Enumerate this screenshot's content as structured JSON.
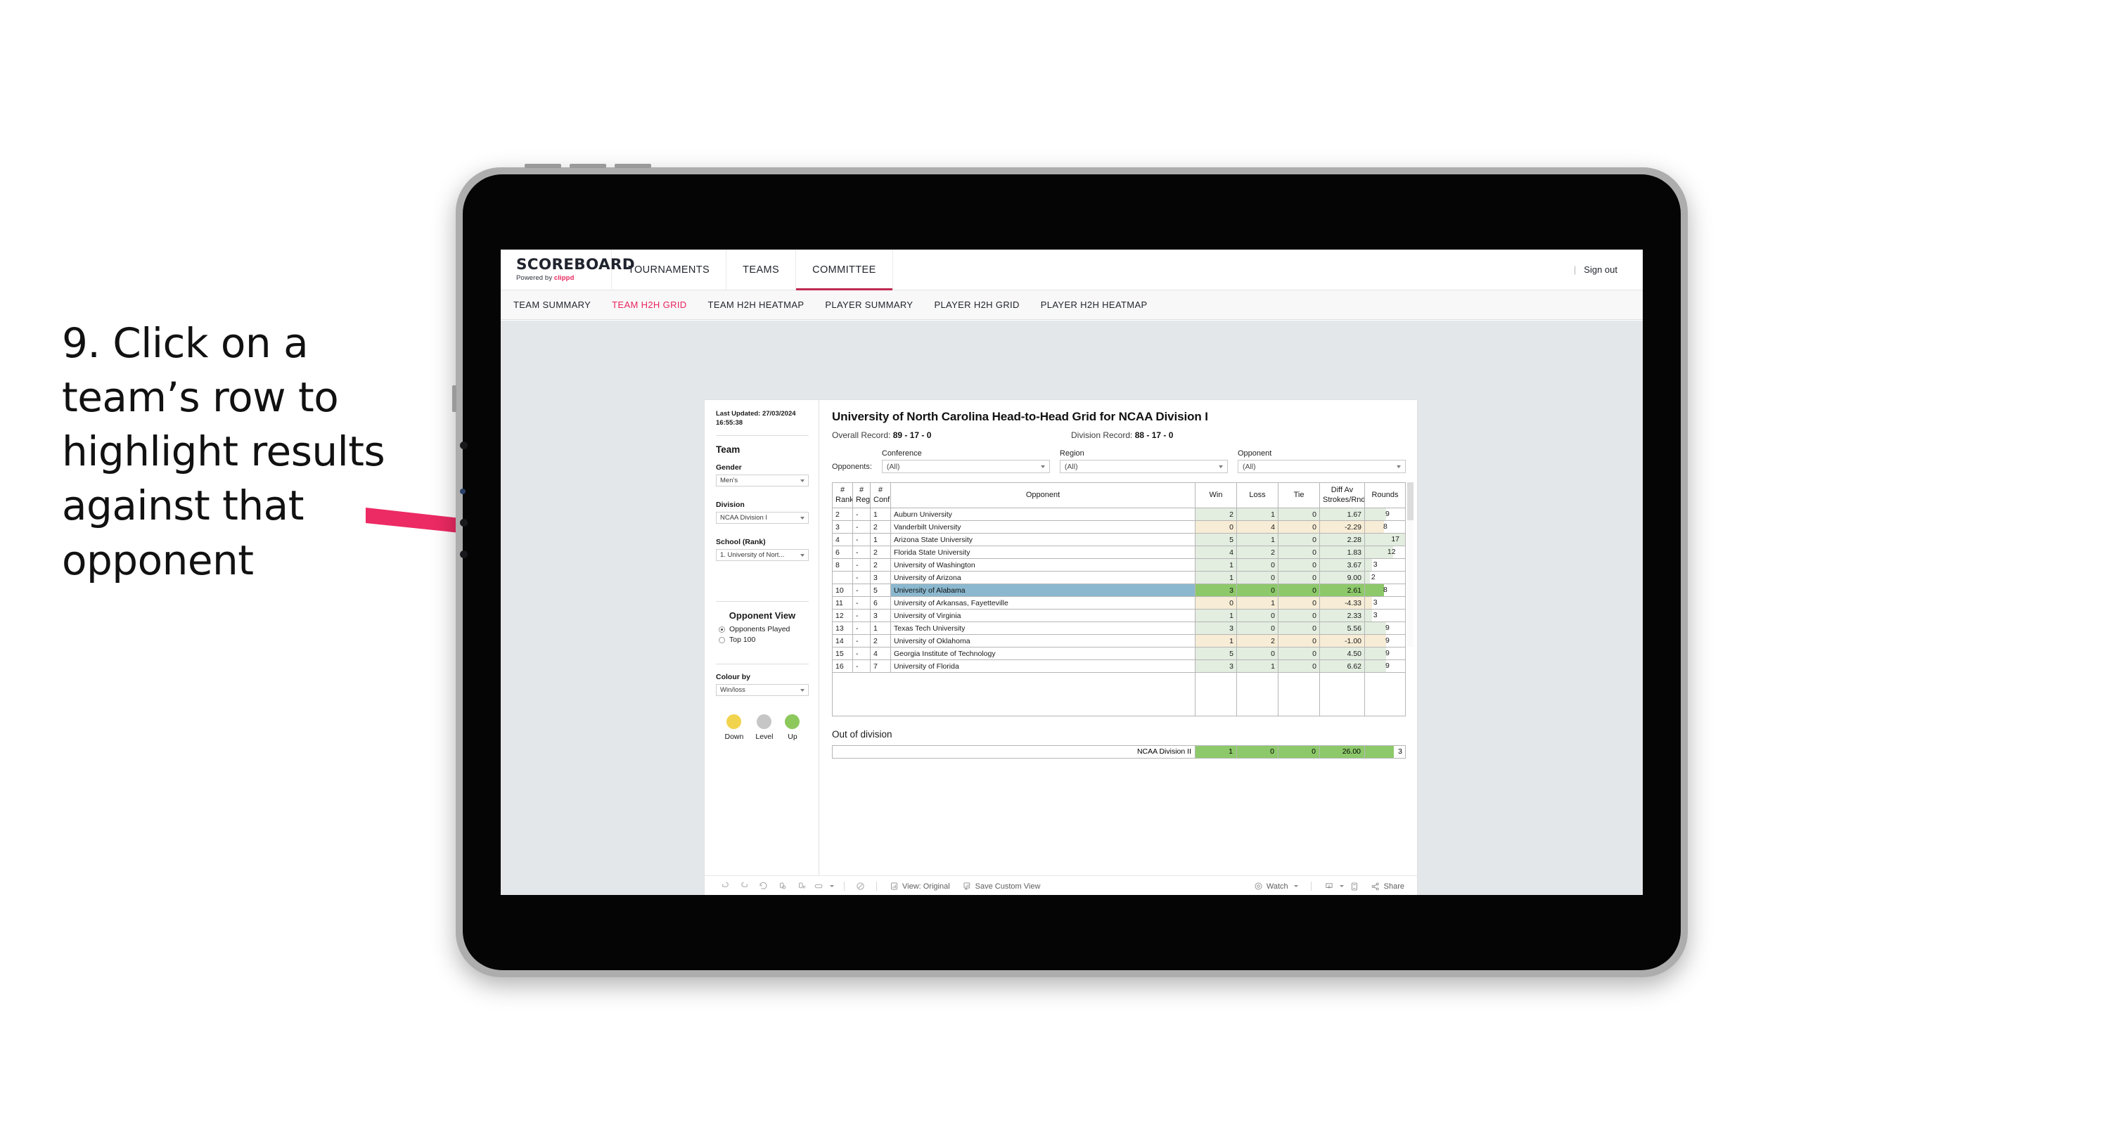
{
  "annotation": {
    "text": "9. Click on a team’s row to highlight results against that opponent"
  },
  "app": {
    "brand_title": "SCOREBOARD",
    "brand_sub_prefix": "Powered by ",
    "brand_sub_name": "clippd",
    "top_nav": [
      {
        "label": "TOURNAMENTS",
        "active": false
      },
      {
        "label": "TEAMS",
        "active": false
      },
      {
        "label": "COMMITTEE",
        "active": true
      }
    ],
    "sign_out": "Sign out",
    "sub_tabs": [
      {
        "label": "TEAM SUMMARY",
        "active": false
      },
      {
        "label": "TEAM H2H GRID",
        "active": true
      },
      {
        "label": "TEAM H2H HEATMAP",
        "active": false
      },
      {
        "label": "PLAYER SUMMARY",
        "active": false
      },
      {
        "label": "PLAYER H2H GRID",
        "active": false
      },
      {
        "label": "PLAYER H2H HEATMAP",
        "active": false
      }
    ]
  },
  "sidebar": {
    "last_updated": "Last Updated: 27/03/2024 16:55:38",
    "team_heading": "Team",
    "gender_label": "Gender",
    "gender_value": "Men’s",
    "division_label": "Division",
    "division_value": "NCAA Division I",
    "school_label": "School (Rank)",
    "school_value": "1. University of Nort...",
    "opponent_view_heading": "Opponent View",
    "opponent_view_options": [
      {
        "label": "Opponents Played",
        "selected": true
      },
      {
        "label": "Top 100",
        "selected": false
      }
    ],
    "colour_by_label": "Colour by",
    "colour_by_value": "Win/loss",
    "legend": [
      {
        "caption": "Down",
        "color": "#f2d34e"
      },
      {
        "caption": "Level",
        "color": "#c6c6c6"
      },
      {
        "caption": "Up",
        "color": "#8cc85c"
      }
    ]
  },
  "main": {
    "title": "University of North Carolina Head-to-Head Grid for NCAA Division I",
    "overall_record_label": "Overall Record: ",
    "overall_record_value": "89 - 17 - 0",
    "division_record_label": "Division Record: ",
    "division_record_value": "88 - 17 - 0",
    "opponents_label": "Opponents:",
    "filters": [
      {
        "label": "Conference",
        "value": "(All)"
      },
      {
        "label": "Region",
        "value": "(All)"
      },
      {
        "label": "Opponent",
        "value": "(All)"
      }
    ],
    "columns": [
      "# Rank",
      "# Reg",
      "# Conf",
      "Opponent",
      "Win",
      "Loss",
      "Tie",
      "Diff Av Strokes/Rnd",
      "Rounds"
    ],
    "column_head_lines": {
      "rank": [
        "#",
        "Rank"
      ],
      "reg": [
        "#",
        "Reg"
      ],
      "conf": [
        "#",
        "Conf"
      ],
      "opponent": [
        "Opponent"
      ],
      "win": [
        "Win"
      ],
      "loss": [
        "Loss"
      ],
      "tie": [
        "Tie"
      ],
      "diff": [
        "Diff Av",
        "Strokes/Rnd"
      ],
      "rounds": [
        "Rounds"
      ]
    },
    "rows": [
      {
        "rank": "2",
        "reg": "-",
        "conf": "1",
        "opponent": "Auburn University",
        "win": "2",
        "loss": "1",
        "tie": "0",
        "diff": "1.67",
        "rounds": "9",
        "fill": "#e3ede0",
        "rounds_pct": 53,
        "highlight": false
      },
      {
        "rank": "3",
        "reg": "-",
        "conf": "2",
        "opponent": "Vanderbilt University",
        "win": "0",
        "loss": "4",
        "tie": "0",
        "diff": "-2.29",
        "rounds": "8",
        "fill": "#f7ecd5",
        "rounds_pct": 47,
        "highlight": false
      },
      {
        "rank": "4",
        "reg": "-",
        "conf": "1",
        "opponent": "Arizona State University",
        "win": "5",
        "loss": "1",
        "tie": "0",
        "diff": "2.28",
        "rounds": "17",
        "fill": "#e3ede0",
        "rounds_pct": 100,
        "highlight": false
      },
      {
        "rank": "6",
        "reg": "-",
        "conf": "2",
        "opponent": "Florida State University",
        "win": "4",
        "loss": "2",
        "tie": "0",
        "diff": "1.83",
        "rounds": "12",
        "fill": "#e3ede0",
        "rounds_pct": 71,
        "highlight": false
      },
      {
        "rank": "8",
        "reg": "-",
        "conf": "2",
        "opponent": "University of Washington",
        "win": "1",
        "loss": "0",
        "tie": "0",
        "diff": "3.67",
        "rounds": "3",
        "fill": "#e3ede0",
        "rounds_pct": 18,
        "highlight": false
      },
      {
        "rank": "",
        "reg": "-",
        "conf": "3",
        "opponent": "University of Arizona",
        "win": "1",
        "loss": "0",
        "tie": "0",
        "diff": "9.00",
        "rounds": "2",
        "fill": "#e3ede0",
        "rounds_pct": 12,
        "highlight": false
      },
      {
        "rank": "10",
        "reg": "-",
        "conf": "5",
        "opponent": "University of Alabama",
        "win": "3",
        "loss": "0",
        "tie": "0",
        "diff": "2.61",
        "rounds": "8",
        "fill": "#8dc96a",
        "rounds_pct": 47,
        "highlight": true
      },
      {
        "rank": "11",
        "reg": "-",
        "conf": "6",
        "opponent": "University of Arkansas, Fayetteville",
        "win": "0",
        "loss": "1",
        "tie": "0",
        "diff": "-4.33",
        "rounds": "3",
        "fill": "#f7ecd5",
        "rounds_pct": 18,
        "highlight": false
      },
      {
        "rank": "12",
        "reg": "-",
        "conf": "3",
        "opponent": "University of Virginia",
        "win": "1",
        "loss": "0",
        "tie": "0",
        "diff": "2.33",
        "rounds": "3",
        "fill": "#e3ede0",
        "rounds_pct": 18,
        "highlight": false
      },
      {
        "rank": "13",
        "reg": "-",
        "conf": "1",
        "opponent": "Texas Tech University",
        "win": "3",
        "loss": "0",
        "tie": "0",
        "diff": "5.56",
        "rounds": "9",
        "fill": "#e3ede0",
        "rounds_pct": 53,
        "highlight": false
      },
      {
        "rank": "14",
        "reg": "-",
        "conf": "2",
        "opponent": "University of Oklahoma",
        "win": "1",
        "loss": "2",
        "tie": "0",
        "diff": "-1.00",
        "rounds": "9",
        "fill": "#f7ecd5",
        "rounds_pct": 53,
        "highlight": false
      },
      {
        "rank": "15",
        "reg": "-",
        "conf": "4",
        "opponent": "Georgia Institute of Technology",
        "win": "5",
        "loss": "0",
        "tie": "0",
        "diff": "4.50",
        "rounds": "9",
        "fill": "#e3ede0",
        "rounds_pct": 53,
        "highlight": false
      },
      {
        "rank": "16",
        "reg": "-",
        "conf": "7",
        "opponent": "University of Florida",
        "win": "3",
        "loss": "1",
        "tie": "0",
        "diff": "6.62",
        "rounds": "9",
        "fill": "#e3ede0",
        "rounds_pct": 53,
        "highlight": false
      }
    ],
    "out_of_division_heading": "Out of division",
    "out_of_division_row": {
      "label": "NCAA Division II",
      "win": "1",
      "loss": "0",
      "tie": "0",
      "diff": "26.00",
      "rounds": "3",
      "fill": "#8dc96a",
      "rounds_pct": 72
    }
  },
  "toolbar": {
    "view_label": "View: Original",
    "save_label": "Save Custom View",
    "watch_label": "Watch",
    "share_label": "Share"
  },
  "colors": {
    "accent_pink": "#e8245c",
    "active_underline": "#bf2a52",
    "highlight_blue": "#8bb8cf",
    "win_green": "#8dc96a",
    "pale_green": "#e3ede0",
    "pale_tan": "#f7ecd5",
    "arrow_pink": "#ec2a63"
  }
}
